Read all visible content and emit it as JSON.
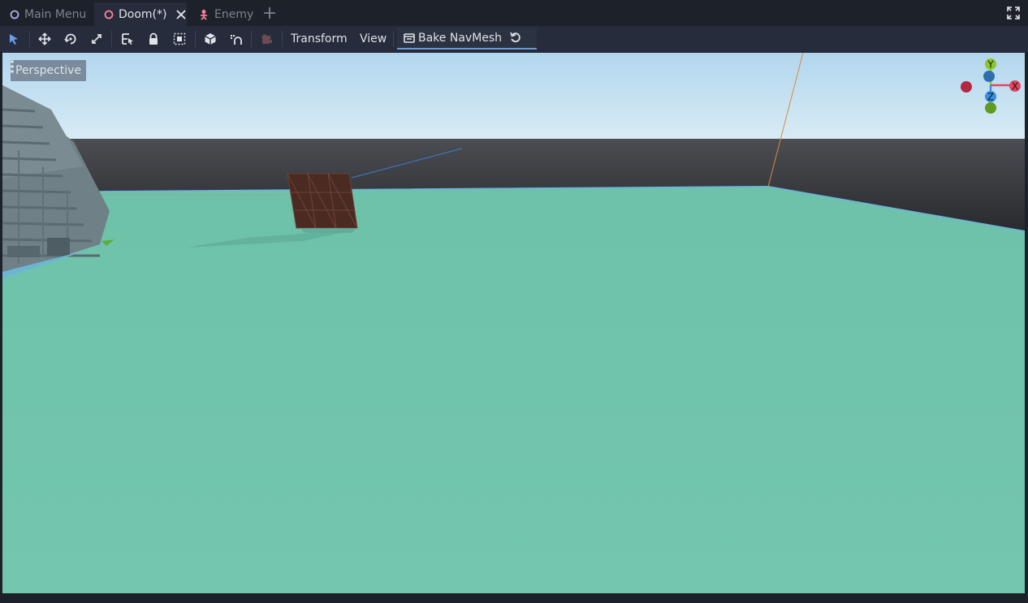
{
  "scene_tabs": [
    {
      "label": "Main Menu",
      "icon": "node-circle-icon"
    },
    {
      "label": "Doom(*)",
      "icon": "node-circle-icon"
    },
    {
      "label": "Enemy",
      "icon": "skeleton-icon"
    }
  ],
  "toolbar": {
    "tools": [
      "select-tool",
      "move-tool",
      "rotate-tool",
      "scale-tool",
      "list-select-tool",
      "lock-icon",
      "group-icon",
      "local-space-icon",
      "snap-icon",
      "camera-preview-icon"
    ],
    "transform_menu": "Transform",
    "view_menu": "View",
    "bake_navmesh": "Bake NavMesh"
  },
  "viewport": {
    "view_menu_label": "Perspective",
    "gizmo": {
      "y": "Y",
      "x": "X",
      "z": "Z"
    }
  },
  "colors": {
    "accent": "#6b99d8",
    "ground": "#72c4ad",
    "axis_x": "#e0485f",
    "axis_y": "#8bc72a",
    "axis_z": "#3a8fe0"
  }
}
